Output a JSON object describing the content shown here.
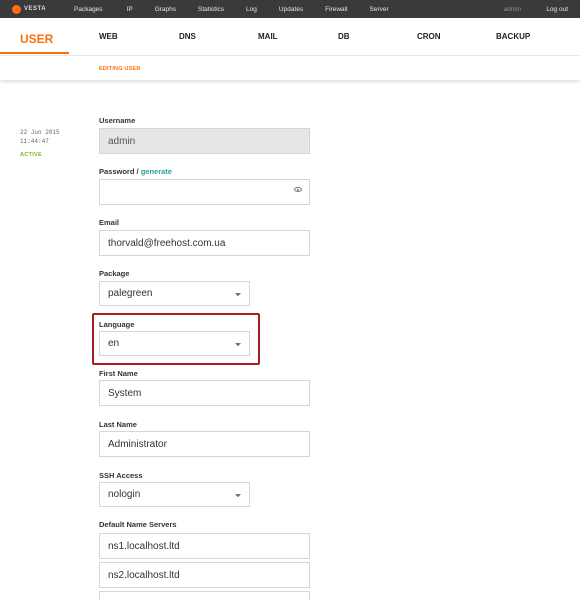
{
  "topbar": {
    "logo_text": "VESTA",
    "nav": [
      "Packages",
      "IP",
      "Graphs",
      "Statistics",
      "Log",
      "Updates",
      "Firewall",
      "Server"
    ],
    "user": "admin",
    "logout": "Log out"
  },
  "tabs": {
    "active": "USER",
    "items": [
      "WEB",
      "DNS",
      "MAIL",
      "DB",
      "CRON",
      "BACKUP"
    ]
  },
  "subheader": "EDITING USER",
  "meta": {
    "date": "22 Jun 2015",
    "time": "11:44:47",
    "status": "ACTIVE"
  },
  "form": {
    "username_label": "Username",
    "username_value": "admin",
    "password_label": "Password",
    "password_sep": " / ",
    "password_link": "generate",
    "email_label": "Email",
    "email_value": "thorvald@freehost.com.ua",
    "package_label": "Package",
    "package_value": "palegreen",
    "language_label": "Language",
    "language_value": "en",
    "firstname_label": "First Name",
    "firstname_value": "System",
    "lastname_label": "Last Name",
    "lastname_value": "Administrator",
    "ssh_label": "SSH Access",
    "ssh_value": "nologin",
    "ns_label": "Default Name Servers",
    "ns1_value": "ns1.localhost.ltd",
    "ns2_value": "ns2.localhost.ltd"
  },
  "colors": {
    "accent": "#ff6e0e",
    "topbar": "#3a3a3a",
    "status_active": "#7cb91e",
    "link": "#2a9f9b",
    "highlight": "#a61e1e"
  }
}
